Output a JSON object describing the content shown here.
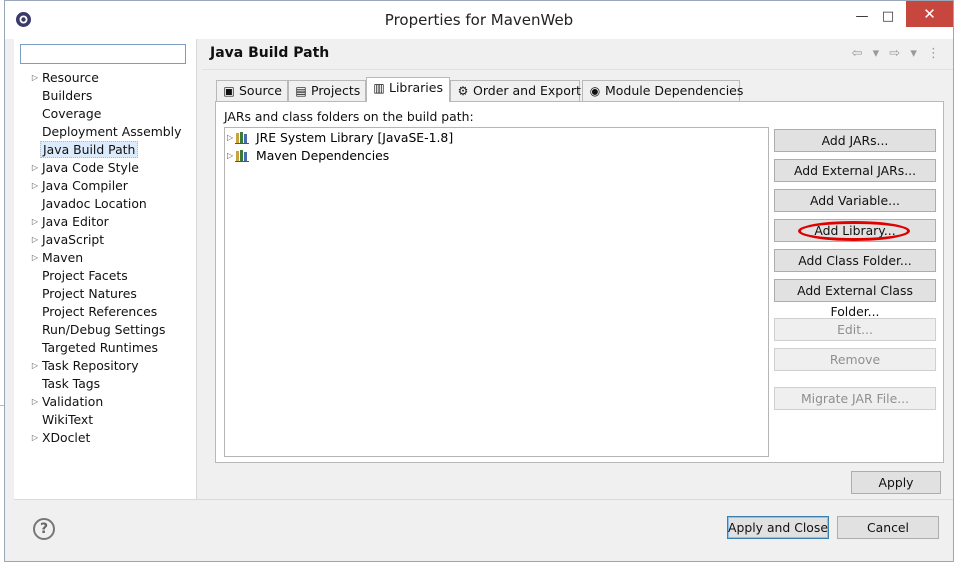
{
  "window": {
    "title": "Properties for MavenWeb",
    "minimize_glyph": "—",
    "maximize_glyph": "□",
    "close_glyph": "✕"
  },
  "sidebar": {
    "filter_value": "",
    "items": [
      {
        "label": "Resource",
        "expandable": true
      },
      {
        "label": "Builders",
        "expandable": false
      },
      {
        "label": "Coverage",
        "expandable": false
      },
      {
        "label": "Deployment Assembly",
        "expandable": false
      },
      {
        "label": "Java Build Path",
        "expandable": false,
        "selected": true
      },
      {
        "label": "Java Code Style",
        "expandable": true
      },
      {
        "label": "Java Compiler",
        "expandable": true
      },
      {
        "label": "Javadoc Location",
        "expandable": false
      },
      {
        "label": "Java Editor",
        "expandable": true
      },
      {
        "label": "JavaScript",
        "expandable": true
      },
      {
        "label": "Maven",
        "expandable": true
      },
      {
        "label": "Project Facets",
        "expandable": false
      },
      {
        "label": "Project Natures",
        "expandable": false
      },
      {
        "label": "Project References",
        "expandable": false
      },
      {
        "label": "Run/Debug Settings",
        "expandable": false
      },
      {
        "label": "Targeted Runtimes",
        "expandable": false
      },
      {
        "label": "Task Repository",
        "expandable": true
      },
      {
        "label": "Task Tags",
        "expandable": false
      },
      {
        "label": "Validation",
        "expandable": true
      },
      {
        "label": "WikiText",
        "expandable": false
      },
      {
        "label": "XDoclet",
        "expandable": true
      }
    ]
  },
  "header": {
    "title": "Java Build Path",
    "nav_glyphs": "⇦ ▾ ⇨ ▾ ⋮"
  },
  "tabs": [
    {
      "label": "Source",
      "icon": "source-folder-icon",
      "glyph": "▣"
    },
    {
      "label": "Projects",
      "icon": "projects-icon",
      "glyph": "▤"
    },
    {
      "label": "Libraries",
      "icon": "libraries-icon",
      "glyph": "▥",
      "active": true
    },
    {
      "label": "Order and Export",
      "icon": "order-export-icon",
      "glyph": "⚙"
    },
    {
      "label": "Module Dependencies",
      "icon": "module-icon",
      "glyph": "◉"
    }
  ],
  "libraries": {
    "section_label": "JARs and class folders on the build path:",
    "entries": [
      {
        "label": "JRE System Library [JavaSE-1.8]",
        "icon": "library-icon"
      },
      {
        "label": "Maven Dependencies",
        "icon": "library-icon"
      }
    ]
  },
  "buttons": {
    "add_jars": "Add JARs...",
    "add_external_jars": "Add External JARs...",
    "add_variable": "Add Variable...",
    "add_library": "Add Library...",
    "add_class_folder": "Add Class Folder...",
    "add_external_class_folder": "Add External Class Folder...",
    "edit": "Edit...",
    "remove": "Remove",
    "migrate_jar": "Migrate JAR File...",
    "apply": "Apply",
    "apply_and_close": "Apply and Close",
    "cancel": "Cancel"
  },
  "help_glyph": "?",
  "colors": {
    "highlight_ring": "#e00000",
    "window_close": "#c7463e",
    "selection": "#dcebfc"
  }
}
